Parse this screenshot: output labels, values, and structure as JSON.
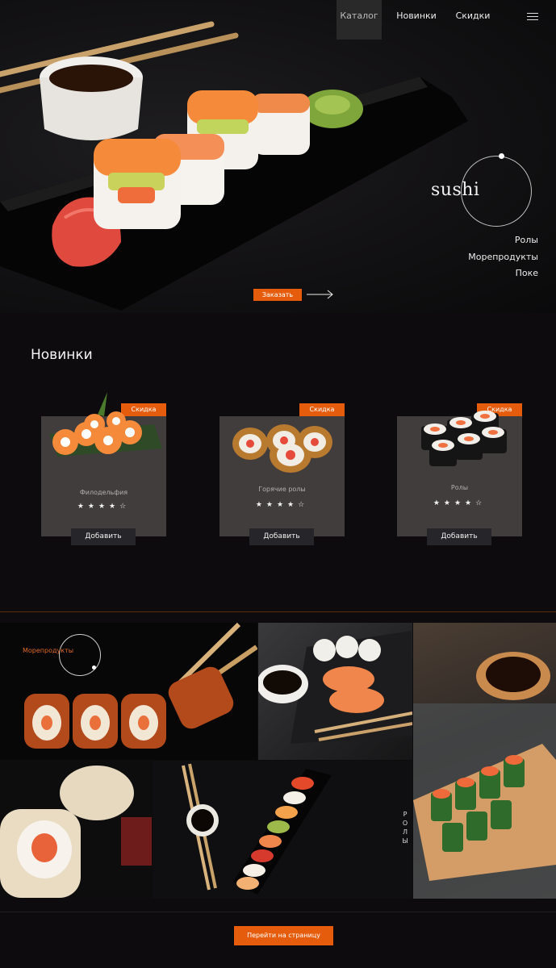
{
  "nav": {
    "catalog": "Каталог",
    "new": "Новинки",
    "sale": "Скидки",
    "menu_icon": "hamburger-icon"
  },
  "hero": {
    "logo_word": "sushi",
    "links": [
      "Ролы",
      "Морепродукты",
      "Поке"
    ],
    "order_label": "Заказать",
    "arrow_icon": "arrow-right-icon"
  },
  "new_section": {
    "title": "Новинки",
    "cards": [
      {
        "badge": "Скидка",
        "name": "Филодельфия",
        "stars": "★★★★☆",
        "rating": 4,
        "add_label": "Добавить"
      },
      {
        "badge": "Скидка",
        "name": "Горячие ролы",
        "stars": "★★★★☆",
        "rating": 4,
        "add_label": "Добавить"
      },
      {
        "badge": "Скидка",
        "name": "Ролы",
        "stars": "★★★★☆",
        "rating": 4,
        "add_label": "Добавить"
      }
    ]
  },
  "gallery": {
    "seafood_label": "Морепродукты",
    "rolls_vertical": "РОЛЫ"
  },
  "footer": {
    "go_label": "Перейти на страницу"
  },
  "colors": {
    "accent": "#e55c0c",
    "background": "#0d0b0d",
    "card": "#423d3d"
  }
}
